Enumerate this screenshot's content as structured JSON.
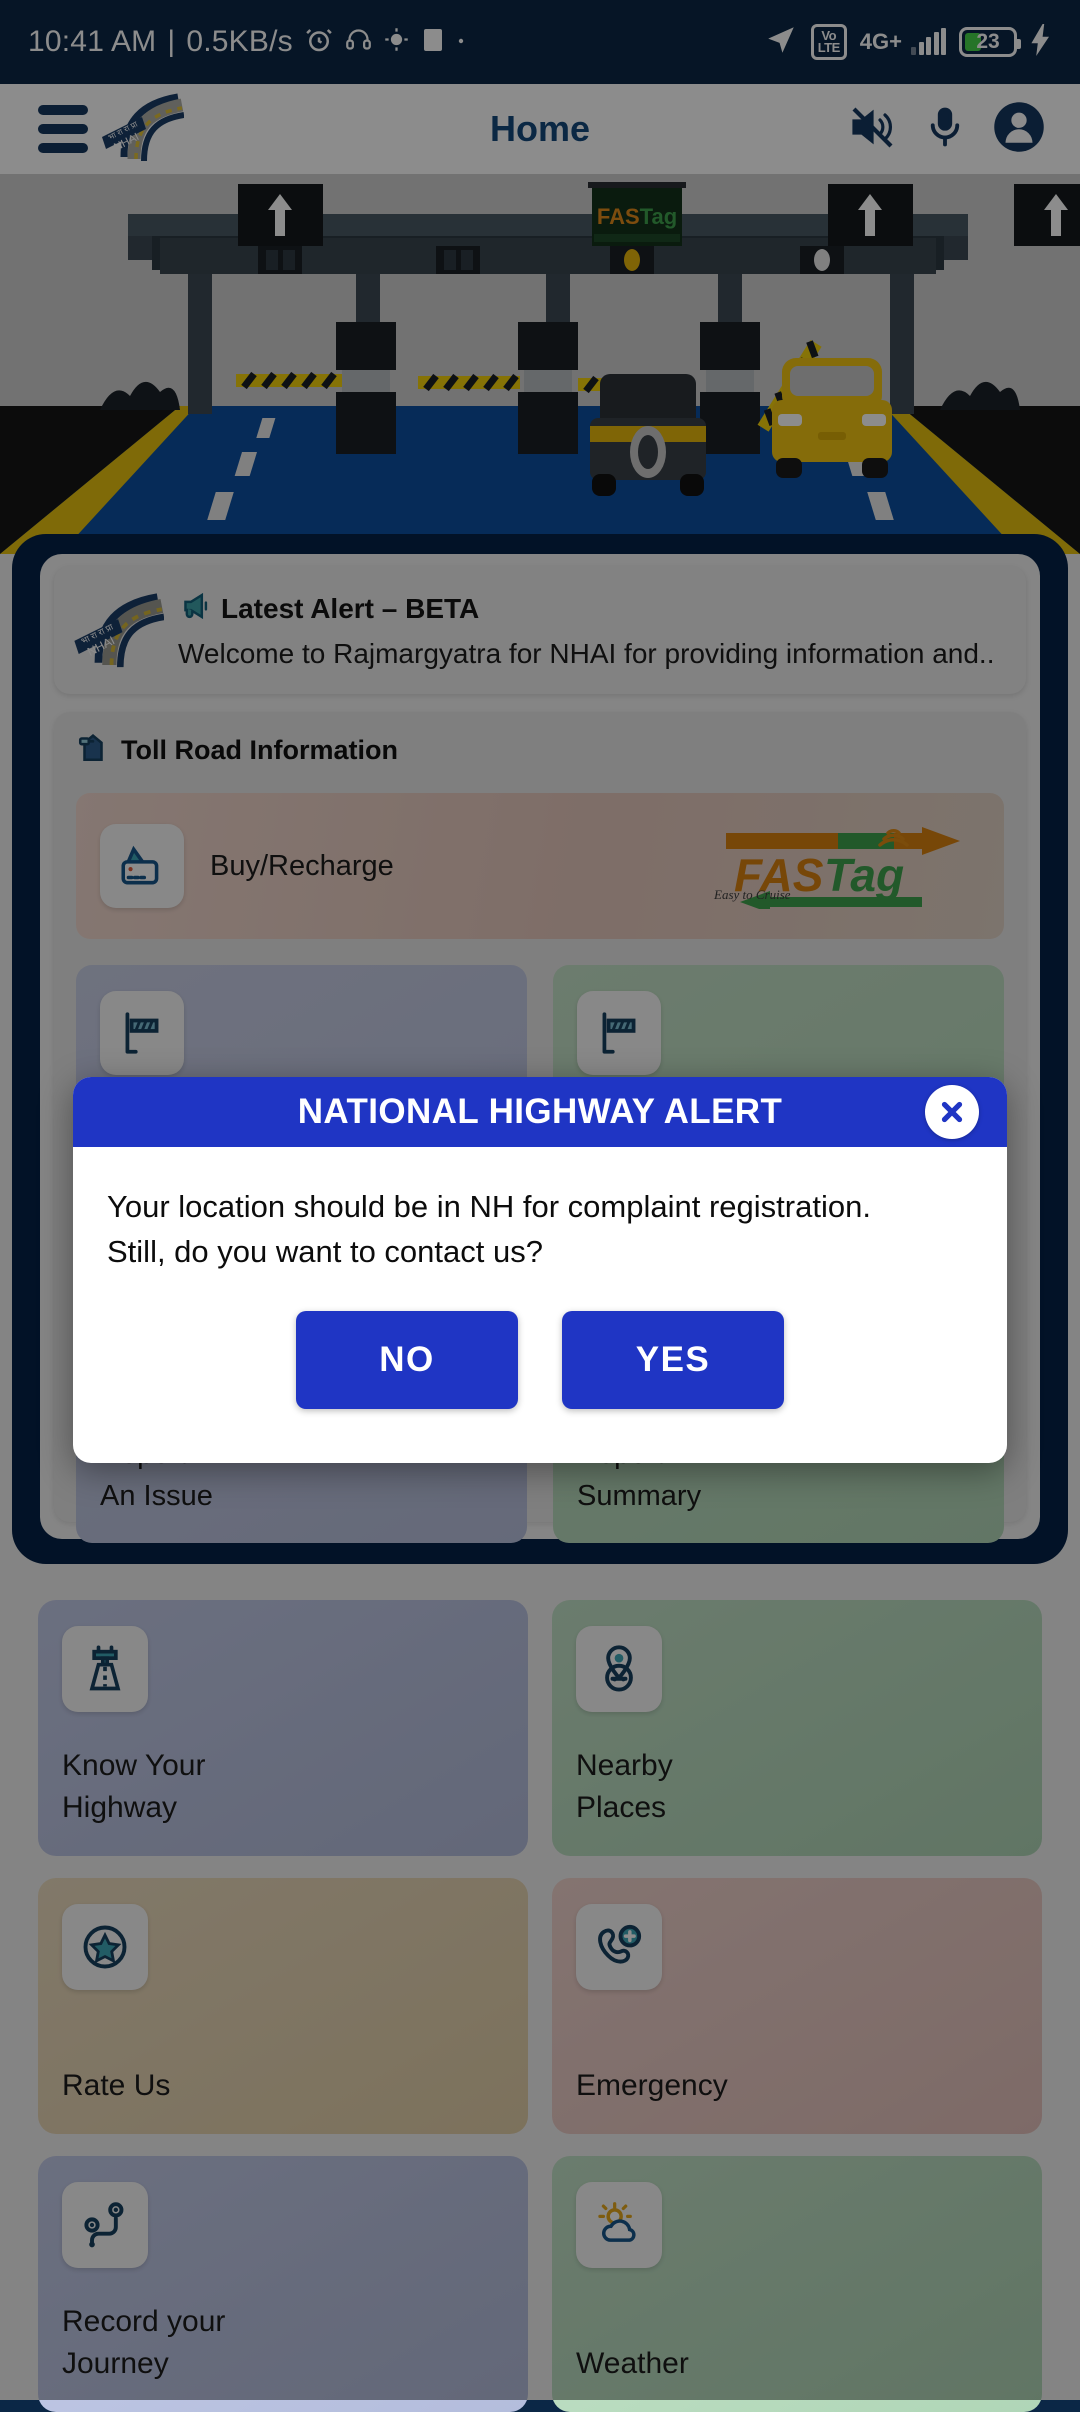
{
  "status_bar": {
    "time": "10:41 AM",
    "separator": "|",
    "net_speed": "0.5KB/s",
    "icons_left": [
      "alarm-icon",
      "headset-icon",
      "gps-fix-icon",
      "square-icon",
      "dot-icon"
    ],
    "volte_line1": "Vo",
    "volte_line2": "LTE",
    "network_type": "4G+",
    "battery_percent": "23",
    "battery_charging": true,
    "icons_right": [
      "location-arrow-icon",
      "volte-icon",
      "signal-bars-icon",
      "battery-icon",
      "charging-bolt-icon"
    ]
  },
  "app_bar": {
    "menu_icon": "hamburger-menu-icon",
    "logo": "nhai-logo",
    "title": "Home",
    "actions": [
      {
        "name": "mute-icon"
      },
      {
        "name": "microphone-icon"
      },
      {
        "name": "profile-icon"
      }
    ]
  },
  "hero": {
    "name": "toll-plaza-illustration",
    "sign_board_text": "FASTag"
  },
  "alert": {
    "logo": "nhai-logo",
    "megaphone_icon": "megaphone-icon",
    "title": "Latest Alert – BETA",
    "message": "Welcome to Rajmargyatra for NHAI for providing information and.."
  },
  "toll_section": {
    "icon": "toll-booth-icon",
    "title": "Toll Road Information",
    "buy_recharge": {
      "icon": "wallet-card-icon",
      "label": "Buy/Recharge",
      "brand_logo": "fastag-logo",
      "brand_name": "FASTag",
      "brand_tagline": "Easy to Cruise"
    },
    "tiles": [
      {
        "icon": "toll-barrier-icon",
        "label_line1": "Report",
        "label_line2": "An Issue"
      },
      {
        "icon": "toll-barrier-icon",
        "label_line1": "Report",
        "label_line2": "Summary"
      }
    ]
  },
  "grid": [
    {
      "icon": "highway-tower-icon",
      "label_line1": "Know Your",
      "label_line2": "Highway",
      "theme": "g-blue"
    },
    {
      "icon": "location-pin-icon",
      "label_line1": "Nearby",
      "label_line2": "Places",
      "theme": "g-green"
    },
    {
      "icon": "star-badge-icon",
      "label_line1": "Rate Us",
      "label_line2": "",
      "theme": "g-gold"
    },
    {
      "icon": "emergency-call-icon",
      "label_line1": "Emergency",
      "label_line2": "",
      "theme": "g-rose"
    },
    {
      "icon": "route-journey-icon",
      "label_line1": "Record your",
      "label_line2": "Journey",
      "theme": "g-blue"
    },
    {
      "icon": "weather-sun-cloud-icon",
      "label_line1": "Weather",
      "label_line2": "",
      "theme": "g-green"
    }
  ],
  "dialog": {
    "title": "NATIONAL HIGHWAY ALERT",
    "close_icon": "close-icon",
    "message": "Your location should be in NH for complaint registration.\n Still, do you want to contact us?",
    "no_label": "NO",
    "yes_label": "YES",
    "header_color": "#1f35c4",
    "button_color": "#1f35c4"
  }
}
